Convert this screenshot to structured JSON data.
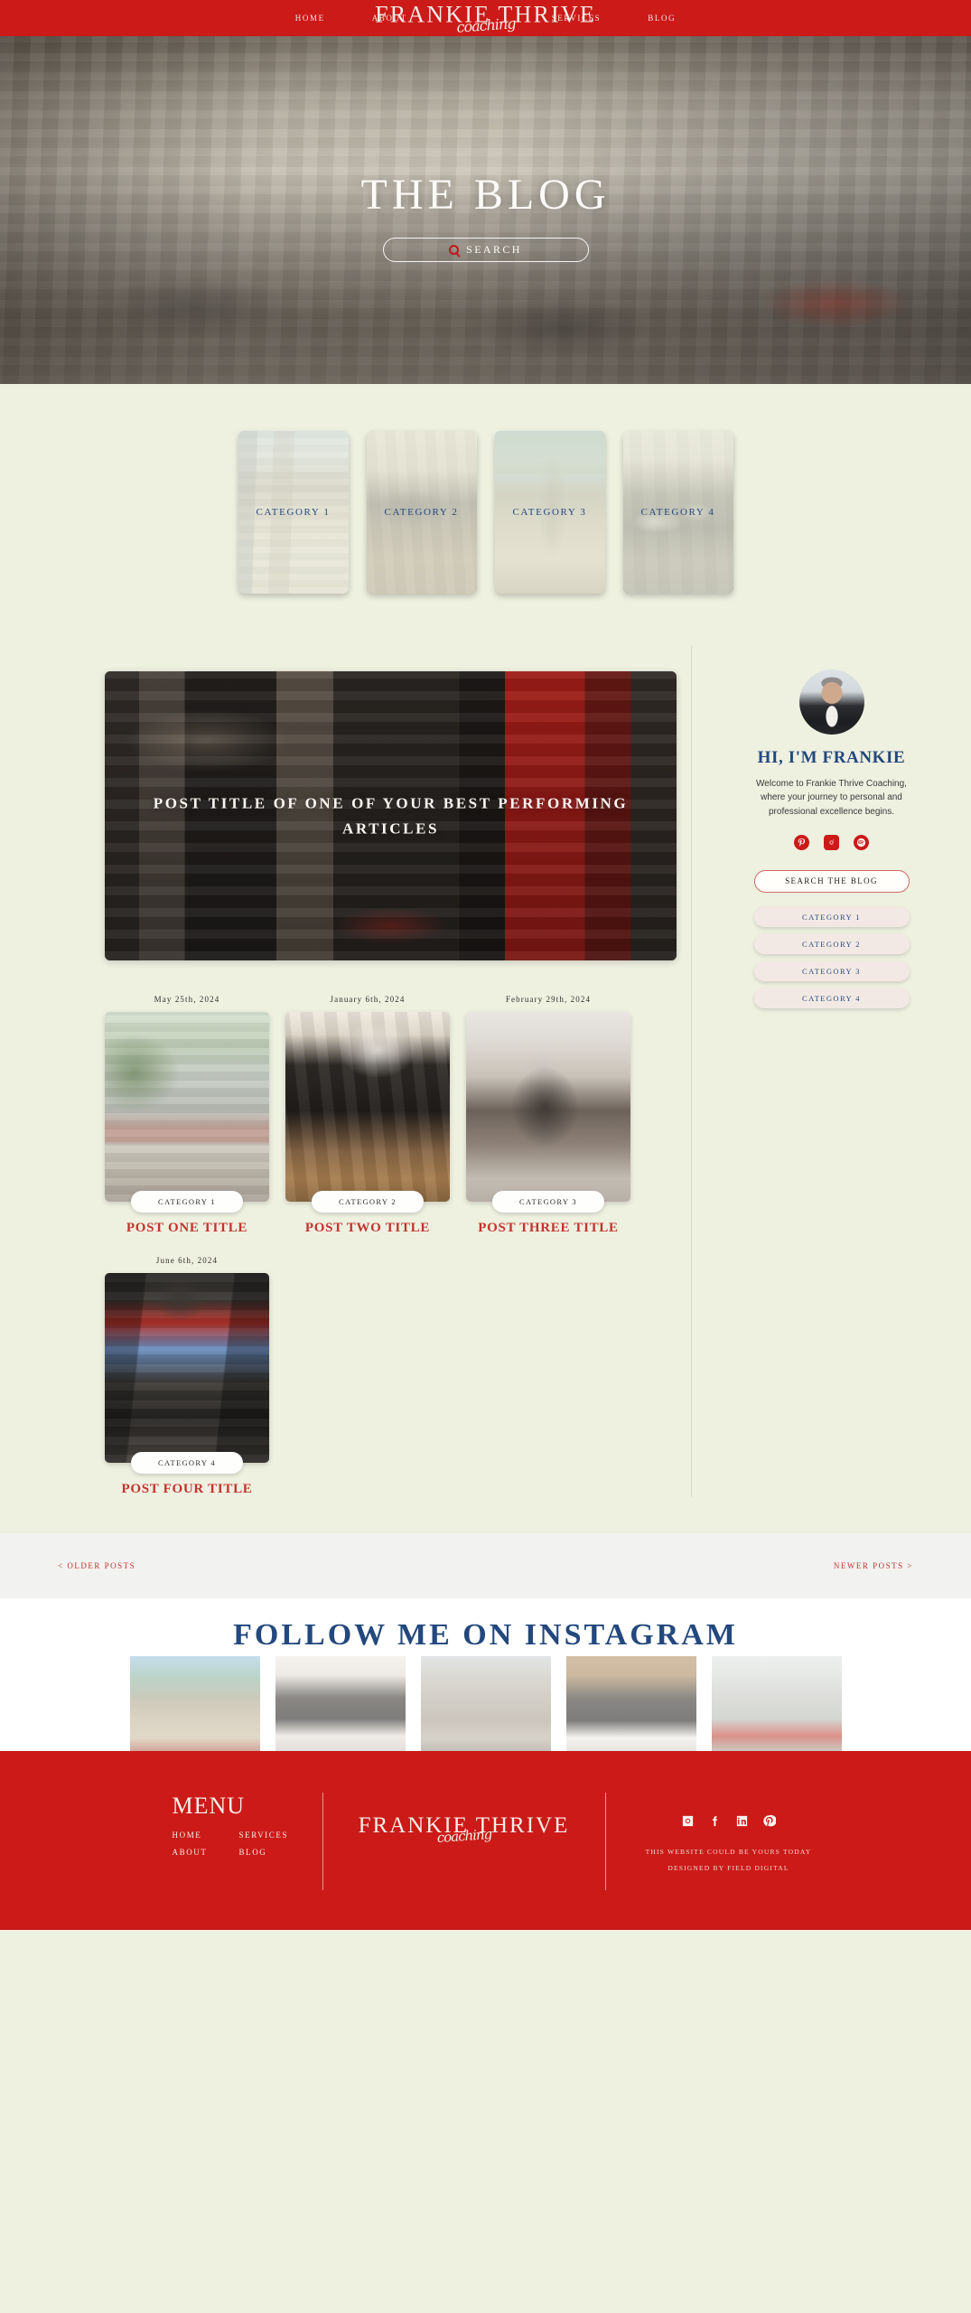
{
  "header": {
    "nav_left": [
      {
        "label": "HOME"
      },
      {
        "label": "ABOUT"
      }
    ],
    "nav_right": [
      {
        "label": "SERVICES"
      },
      {
        "label": "BLOG"
      }
    ],
    "logo_main": "FRANKIE THRIVE",
    "logo_script": "coaching",
    "bg_color": "#cb1a18"
  },
  "hero": {
    "title": "THE BLOG",
    "search_label": "SEARCH",
    "search_icon": "search-icon"
  },
  "categories_strip": [
    {
      "label": "CATEGORY 1"
    },
    {
      "label": "CATEGORY 2"
    },
    {
      "label": "CATEGORY 3"
    },
    {
      "label": "CATEGORY 4"
    }
  ],
  "featured": {
    "title": "POST TITLE OF ONE OF YOUR BEST PERFORMING ARTICLES"
  },
  "posts": [
    {
      "date": "May 25th, 2024",
      "category": "CATEGORY 1",
      "title": "POST ONE TITLE"
    },
    {
      "date": "January 6th, 2024",
      "category": "CATEGORY 2",
      "title": "POST TWO TITLE"
    },
    {
      "date": "February 29th, 2024",
      "category": "CATEGORY 3",
      "title": "POST THREE TITLE"
    },
    {
      "date": "June 6th, 2024",
      "category": "CATEGORY 4",
      "title": "POST FOUR TITLE"
    }
  ],
  "sidebar": {
    "avatar": "frankie-avatar",
    "name": "HI, I'M FRANKIE",
    "description": "Welcome to Frankie Thrive Coaching, where your journey to personal and professional excellence begins.",
    "socials": [
      {
        "name": "pinterest-icon"
      },
      {
        "name": "instagram-icon"
      },
      {
        "name": "spotify-icon"
      }
    ],
    "search_button": "SEARCH THE BLOG",
    "categories": [
      {
        "label": "CATEGORY 1"
      },
      {
        "label": "CATEGORY 2"
      },
      {
        "label": "CATEGORY 3"
      },
      {
        "label": "CATEGORY 4"
      }
    ]
  },
  "pagination": {
    "older": "< OLDER POSTS",
    "newer": "NEWER POSTS >"
  },
  "instagram": {
    "title": "FOLLOW ME ON INSTAGRAM",
    "cells": [
      {
        "name": "instagram-photo-1"
      },
      {
        "name": "instagram-photo-2"
      },
      {
        "name": "instagram-photo-3"
      },
      {
        "name": "instagram-photo-4"
      },
      {
        "name": "instagram-photo-5"
      }
    ]
  },
  "footer": {
    "menu_title": "MENU",
    "links": [
      {
        "label": "HOME"
      },
      {
        "label": "SERVICES"
      },
      {
        "label": "ABOUT"
      },
      {
        "label": "BLOG"
      }
    ],
    "logo_main": "FRANKIE THRIVE",
    "logo_script": "coaching",
    "socials": [
      {
        "name": "instagram-icon"
      },
      {
        "name": "facebook-icon"
      },
      {
        "name": "linkedin-icon"
      },
      {
        "name": "pinterest-icon"
      }
    ],
    "note_line1": "THIS WEBSITE COULD BE YOURS TODAY",
    "note_line2": "DESIGNED BY FIELD DIGITAL"
  },
  "theme": {
    "red": "#cb1a18",
    "navy": "#23487d",
    "cream": "#eef0e0",
    "post_title_red": "#c3332e"
  }
}
